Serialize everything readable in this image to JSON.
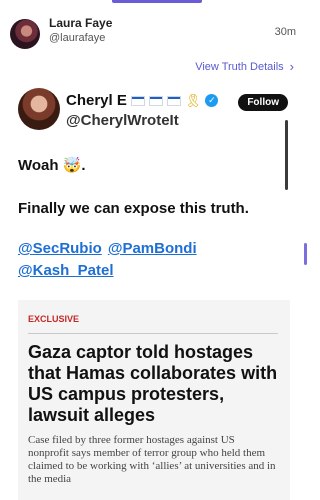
{
  "post": {
    "author_name": "Laura Faye",
    "author_handle": "@laurafaye",
    "time": "30m",
    "view_details_label": "View Truth Details",
    "chevron_glyph": "›"
  },
  "embed": {
    "name": "Cheryl E",
    "flags": [
      "israel-flag",
      "israel-flag",
      "israel-flag"
    ],
    "ribbon_glyph": "🎗",
    "handle": "@CherylWroteIt",
    "follow_label": "Follow",
    "line1": "Woah 🤯.",
    "line2": "Finally we can expose this truth.",
    "mentions_row1": [
      "@SecRubio",
      "@PamBondi"
    ],
    "mentions_row2": [
      "@Kash_Patel"
    ]
  },
  "article": {
    "tag": "EXCLUSIVE",
    "headline": "Gaza captor told hostages that Hamas collaborates with US campus protesters, lawsuit alleges",
    "summary": "Case filed by three former hostages against US nonprofit says member of terror group who held them claimed to be working with ‘allies’ at universities and in the media"
  },
  "colors": {
    "accent": "#6b5bd6",
    "link": "#1d6fd6",
    "exclusive": "#c62828",
    "verified": "#1d9bf0"
  }
}
